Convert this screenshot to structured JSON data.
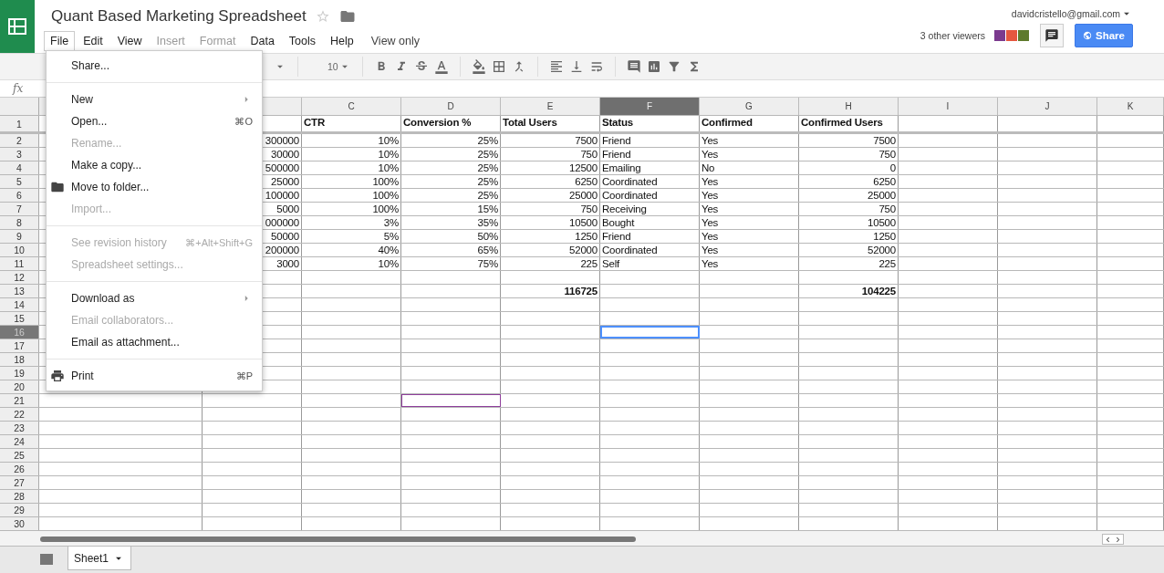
{
  "document": {
    "title": "Quant Based Marketing Spreadsheet",
    "starred": false
  },
  "account": {
    "email": "davidcristello@gmail.com"
  },
  "viewers": {
    "label": "3 other viewers",
    "people": [
      {
        "color": "#7b3a8e"
      },
      {
        "color": "#e5573f"
      },
      {
        "color": "#5e7a2c"
      }
    ]
  },
  "share_button": {
    "label": "Share"
  },
  "menubar": [
    {
      "label": "File",
      "selected": true,
      "disabled": false
    },
    {
      "label": "Edit",
      "selected": false,
      "disabled": false
    },
    {
      "label": "View",
      "selected": false,
      "disabled": false
    },
    {
      "label": "Insert",
      "selected": false,
      "disabled": true
    },
    {
      "label": "Format",
      "selected": false,
      "disabled": true
    },
    {
      "label": "Data",
      "selected": false,
      "disabled": false
    },
    {
      "label": "Tools",
      "selected": false,
      "disabled": false
    },
    {
      "label": "Help",
      "selected": false,
      "disabled": false
    }
  ],
  "mode_label": "View only",
  "toolbar": {
    "font_size": "10"
  },
  "formula_bar": {
    "label": "fx"
  },
  "file_menu": [
    [
      {
        "label": "Share...",
        "disabled": false
      }
    ],
    [
      {
        "label": "New",
        "disabled": false,
        "submenu": true
      },
      {
        "label": "Open...",
        "disabled": false,
        "shortcut": "⌘O"
      },
      {
        "label": "Rename...",
        "disabled": true
      },
      {
        "label": "Make a copy...",
        "disabled": false
      },
      {
        "label": "Move to folder...",
        "disabled": false
      },
      {
        "label": "Import...",
        "disabled": true
      }
    ],
    [
      {
        "label": "See revision history",
        "disabled": true,
        "shortcut": "⌘+Alt+Shift+G"
      },
      {
        "label": "Spreadsheet settings...",
        "disabled": true
      }
    ],
    [
      {
        "label": "Download as",
        "disabled": false,
        "submenu": true
      },
      {
        "label": "Email collaborators...",
        "disabled": true
      },
      {
        "label": "Email as attachment...",
        "disabled": false
      }
    ],
    [
      {
        "label": "Print",
        "disabled": false,
        "shortcut": "⌘P"
      }
    ]
  ],
  "columns": [
    {
      "selected": false
    },
    {
      "kind": "number",
      "selected": false
    },
    {
      "letter": "C",
      "kind": "number",
      "selected": false
    },
    {
      "letter": "D",
      "kind": "number",
      "selected": false,
      "viewer_cursor": true
    },
    {
      "letter": "E",
      "kind": "number",
      "selected": false
    },
    {
      "letter": "F",
      "kind": "text",
      "selected": true
    },
    {
      "letter": "G",
      "kind": "text",
      "selected": false
    },
    {
      "letter": "H",
      "kind": "number",
      "selected": false
    },
    {
      "letter": "I",
      "selected": false
    },
    {
      "letter": "J",
      "selected": false
    },
    {
      "letter": "K",
      "selected": false
    }
  ],
  "rows": [
    {
      "num": "1",
      "kind": "header",
      "selected": false,
      "cells": [
        null,
        null,
        "CTR",
        "Conversion %",
        "Total Users",
        "Status",
        "Confirmed",
        "Confirmed Users"
      ]
    },
    {
      "num": "2",
      "kind": "data",
      "selected": false,
      "cells": [
        null,
        "300000",
        "10%",
        "25%",
        "7500",
        "Friend",
        "Yes",
        "7500"
      ]
    },
    {
      "num": "3",
      "kind": "data",
      "selected": false,
      "cells": [
        null,
        "30000",
        "10%",
        "25%",
        "750",
        "Friend",
        "Yes",
        "750"
      ]
    },
    {
      "num": "4",
      "kind": "data",
      "selected": false,
      "cells": [
        null,
        "500000",
        "10%",
        "25%",
        "12500",
        "Emailing",
        "No",
        "0"
      ]
    },
    {
      "num": "5",
      "kind": "data",
      "selected": false,
      "cells": [
        null,
        "25000",
        "100%",
        "25%",
        "6250",
        "Coordinated",
        "Yes",
        "6250"
      ]
    },
    {
      "num": "6",
      "kind": "data",
      "selected": false,
      "cells": [
        null,
        "100000",
        "100%",
        "25%",
        "25000",
        "Coordinated",
        "Yes",
        "25000"
      ]
    },
    {
      "num": "7",
      "kind": "data",
      "selected": false,
      "cells": [
        null,
        "5000",
        "100%",
        "15%",
        "750",
        "Receiving",
        "Yes",
        "750"
      ]
    },
    {
      "num": "8",
      "kind": "data",
      "selected": false,
      "cells": [
        null,
        "000000",
        "3%",
        "35%",
        "10500",
        "Bought",
        "Yes",
        "10500"
      ]
    },
    {
      "num": "9",
      "kind": "data",
      "selected": false,
      "cells": [
        null,
        "50000",
        "5%",
        "50%",
        "1250",
        "Friend",
        "Yes",
        "1250"
      ]
    },
    {
      "num": "10",
      "kind": "data",
      "selected": false,
      "cells": [
        null,
        "200000",
        "40%",
        "65%",
        "52000",
        "Coordinated",
        "Yes",
        "52000"
      ]
    },
    {
      "num": "11",
      "kind": "data",
      "selected": false,
      "cells": [
        null,
        "3000",
        "10%",
        "75%",
        "225",
        "Self",
        "Yes",
        "225"
      ]
    },
    {
      "num": "12",
      "kind": "data",
      "selected": false
    },
    {
      "num": "13",
      "kind": "total",
      "selected": false,
      "cells": [
        null,
        null,
        null,
        null,
        "116725",
        null,
        null,
        "104225"
      ]
    },
    {
      "num": "14",
      "kind": "data",
      "selected": false
    },
    {
      "num": "15",
      "kind": "data",
      "selected": false
    },
    {
      "num": "16",
      "kind": "data",
      "selected": true
    },
    {
      "num": "17",
      "kind": "data",
      "selected": false
    },
    {
      "num": "18",
      "kind": "data",
      "selected": false
    },
    {
      "num": "19",
      "kind": "data",
      "selected": false
    },
    {
      "num": "20",
      "kind": "data",
      "selected": false
    },
    {
      "num": "21",
      "kind": "data",
      "selected": false,
      "viewer_cursor": true
    },
    {
      "num": "22",
      "kind": "data",
      "selected": false
    },
    {
      "num": "23",
      "kind": "data",
      "selected": false
    },
    {
      "num": "24",
      "kind": "data",
      "selected": false
    },
    {
      "num": "25",
      "kind": "data",
      "selected": false
    },
    {
      "num": "26",
      "kind": "data",
      "selected": false
    },
    {
      "num": "27",
      "kind": "data",
      "selected": false
    },
    {
      "num": "28",
      "kind": "data",
      "selected": false
    },
    {
      "num": "29",
      "kind": "data",
      "selected": false
    },
    {
      "num": "30",
      "kind": "data",
      "selected": false
    }
  ],
  "sheets": [
    {
      "label": "Sheet1",
      "selected": true
    }
  ]
}
